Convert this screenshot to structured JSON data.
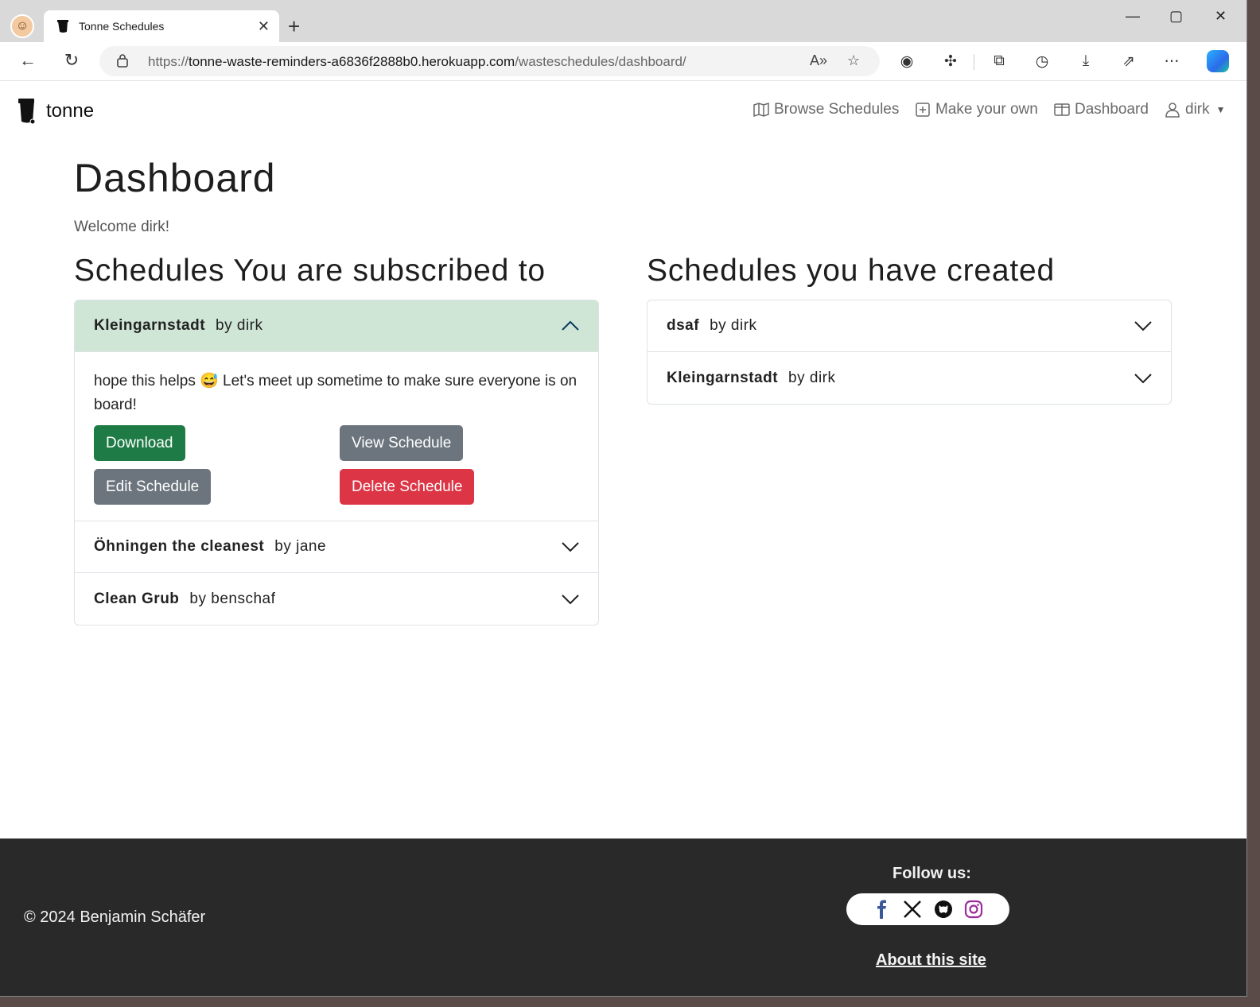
{
  "browser": {
    "tab_title": "Tonne Schedules",
    "tab_close": "✕",
    "new_tab": "+",
    "url_prefix": "https://",
    "url_host": "tonne-waste-reminders-a6836f2888b0.herokuapp.com",
    "url_path": "/wasteschedules/dashboard/",
    "icons": [
      "back-icon",
      "refresh-icon",
      "lock-icon",
      "read-aloud-icon",
      "favorite-star-icon",
      "extension-icon",
      "puzzle-icon",
      "collections-icon",
      "history-icon",
      "download-icon",
      "share-icon",
      "more-icon",
      "copilot-icon"
    ]
  },
  "site": {
    "brand": "tonne",
    "nav": [
      {
        "label": "Browse Schedules",
        "icon": "map-icon"
      },
      {
        "label": "Make your own",
        "icon": "plus-square-icon"
      },
      {
        "label": "Dashboard",
        "icon": "columns-icon"
      },
      {
        "label": "dirk",
        "icon": "person-icon"
      }
    ]
  },
  "dashboard": {
    "title": "Dashboard",
    "welcome": "Welcome dirk!",
    "subscribed_heading": "Schedules You are subscribed to",
    "created_heading": "Schedules you have created",
    "subscribed": [
      {
        "name": "Kleingarnstadt",
        "by": "by dirk",
        "expanded": true
      },
      {
        "name": "Öhningen the cleanest",
        "by": "by jane",
        "expanded": false
      },
      {
        "name": "Clean Grub",
        "by": "by benschaf",
        "expanded": false
      }
    ],
    "expanded_body": {
      "description": "hope this helps 😅 Let's meet up sometime to make sure everyone is on board!",
      "buttons": {
        "download": "Download",
        "view": "View Schedule",
        "edit": "Edit Schedule",
        "delete": "Delete Schedule"
      }
    },
    "created": [
      {
        "name": "dsaf",
        "by": "by dirk"
      },
      {
        "name": "Kleingarnstadt",
        "by": "by dirk"
      }
    ]
  },
  "footer": {
    "copyright": "© 2024 Benjamin Schäfer",
    "follow": "Follow us:",
    "social": [
      "facebook-icon",
      "x-icon",
      "github-icon",
      "instagram-icon"
    ],
    "about": "About this site"
  },
  "colors": {
    "accordion_open_bg": "#cfe6d7",
    "download_btn": "#1e7b45",
    "secondary_btn": "#6c757d",
    "danger_btn": "#dc3545",
    "footer_bg": "#292929"
  }
}
